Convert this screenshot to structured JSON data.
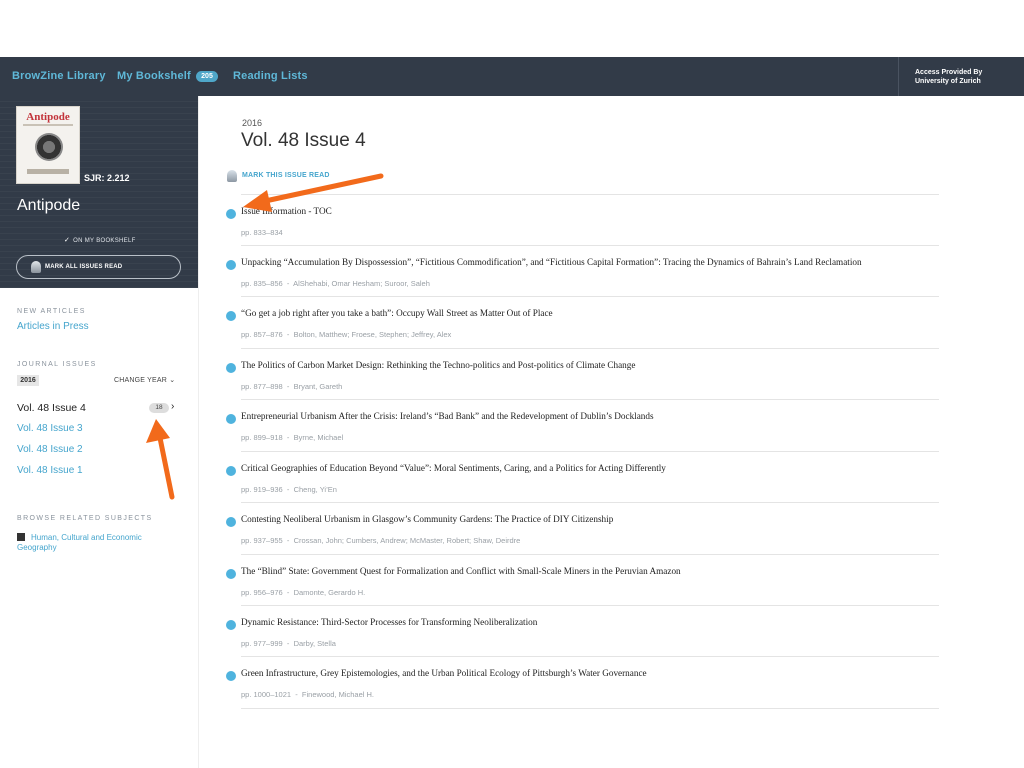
{
  "nav": {
    "library": "BrowZine Library",
    "bookshelf": "My Bookshelf",
    "bookshelf_count": "205",
    "reading_lists": "Reading Lists",
    "access_line1": "Access Provided By",
    "access_line2": "University of Zurich"
  },
  "journal": {
    "cover_title": "Antipode",
    "sjr": "SJR: 2.212",
    "title": "Antipode",
    "on_bookshelf": "ON MY BOOKSHELF",
    "mark_all_read": "MARK ALL ISSUES READ"
  },
  "sidebar": {
    "new_articles_label": "NEW ARTICLES",
    "articles_in_press": "Articles in Press",
    "journal_issues_label": "JOURNAL ISSUES",
    "year": "2016",
    "change_year": "CHANGE YEAR",
    "current_issue": "Vol. 48 Issue 4",
    "current_issue_count": "18",
    "other_issues": [
      "Vol. 48 Issue 3",
      "Vol. 48 Issue 2",
      "Vol. 48 Issue 1"
    ],
    "browse_label": "BROWSE RELATED SUBJECTS",
    "subject": "Human, Cultural and Economic Geography"
  },
  "issue": {
    "year": "2016",
    "title": "Vol. 48 Issue 4",
    "mark_read": "MARK THIS ISSUE READ"
  },
  "articles": [
    {
      "title": "Issue Information - TOC",
      "pages": "pp. 833–834",
      "authors": ""
    },
    {
      "title": "Unpacking “Accumulation By Dispossession”, “Fictitious Commodification”, and “Fictitious Capital Formation”: Tracing the Dynamics of Bahrain’s Land Reclamation",
      "pages": "pp. 835–856",
      "authors": "AlShehabi, Omar Hesham; Suroor, Saleh"
    },
    {
      "title": "“Go get a job right after you take a bath”: Occupy Wall Street as Matter Out of Place",
      "pages": "pp. 857–876",
      "authors": "Bolton, Matthew; Froese, Stephen; Jeffrey, Alex"
    },
    {
      "title": "The Politics of Carbon Market Design: Rethinking the Techno-politics and Post-politics of Climate Change",
      "pages": "pp. 877–898",
      "authors": "Bryant, Gareth"
    },
    {
      "title": "Entrepreneurial Urbanism After the Crisis: Ireland’s “Bad Bank” and the Redevelopment of Dublin’s Docklands",
      "pages": "pp. 899–918",
      "authors": "Byrne, Michael"
    },
    {
      "title": "Critical Geographies of Education Beyond “Value”: Moral Sentiments, Caring, and a Politics for Acting Differently",
      "pages": "pp. 919–936",
      "authors": "Cheng, Yi’En"
    },
    {
      "title": "Contesting Neoliberal Urbanism in Glasgow’s Community Gardens: The Practice of DIY Citizenship",
      "pages": "pp. 937–955",
      "authors": "Crossan, John; Cumbers, Andrew; McMaster, Robert; Shaw, Deirdre"
    },
    {
      "title": "The “Blind” State: Government Quest for Formalization and Conflict with Small-Scale Miners in the Peruvian Amazon",
      "pages": "pp. 956–976",
      "authors": "Damonte, Gerardo H."
    },
    {
      "title": "Dynamic Resistance: Third-Sector Processes for Transforming Neoliberalization",
      "pages": "pp. 977–999",
      "authors": "Darby, Stella"
    },
    {
      "title": "Green Infrastructure, Grey Epistemologies, and the Urban Political Ecology of Pittsburgh’s Water Governance",
      "pages": "pp. 1000–1021",
      "authors": "Finewood, Michael H."
    }
  ],
  "colors": {
    "nav_bg": "#323b48",
    "accent": "#45a5cd",
    "unread_dot": "#4fb3de",
    "annotation_arrow": "#f26a1b"
  },
  "icons": {
    "mark_read": "bookmark-icon",
    "on_shelf": "checkmark-icon",
    "subject": "book-icon",
    "issue_chevron": "chevron-right-icon",
    "year_chevron": "chevron-down-icon"
  }
}
